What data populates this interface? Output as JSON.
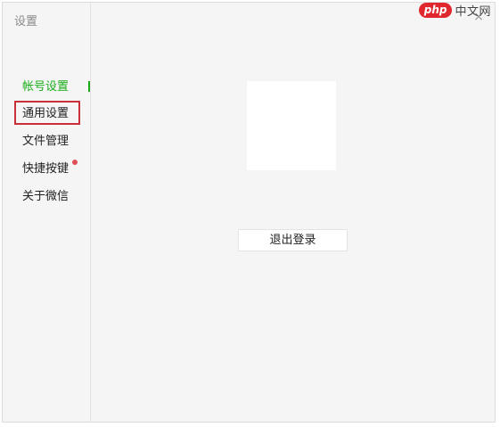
{
  "window": {
    "title": "设置",
    "close_glyph": "×"
  },
  "watermark": {
    "badge": "php",
    "text": "中文网"
  },
  "sidebar": {
    "items": [
      {
        "label": "帐号设置"
      },
      {
        "label": "通用设置"
      },
      {
        "label": "文件管理"
      },
      {
        "label": "快捷按键"
      },
      {
        "label": "关于微信"
      }
    ]
  },
  "main": {
    "logout_label": "退出登录"
  },
  "colors": {
    "accent": "#1aad19",
    "highlight": "#c8303a",
    "badge_dot": "#e0505a"
  }
}
